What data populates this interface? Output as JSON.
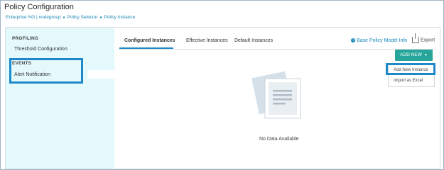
{
  "page": {
    "title": "Policy Configuration"
  },
  "breadcrumb": [
    "Enterprise NG | nodegroup",
    "Policy Selector",
    "Policy Instance"
  ],
  "sidebar": {
    "sections": [
      {
        "heading": "PROFILING",
        "items": [
          "Threshold Configuration"
        ]
      },
      {
        "heading": "EVENTS",
        "items": [
          "Alert Notification"
        ]
      }
    ]
  },
  "tabs": [
    {
      "label": "Configured Instances",
      "active": true
    },
    {
      "label": "Effective Instances",
      "active": false
    },
    {
      "label": "Default Instances",
      "active": false
    }
  ],
  "toolbar": {
    "info_link": "Base Policy Model Info",
    "export_label": "Export",
    "add_button": "ADD NEW"
  },
  "add_menu": [
    "Add New Instance",
    "Import as Excel"
  ],
  "empty_state": {
    "message": "No Data Available"
  },
  "colors": {
    "accent": "#1e88c8",
    "button": "#26a69a",
    "sidebar_bg": "#e4f9fc"
  }
}
